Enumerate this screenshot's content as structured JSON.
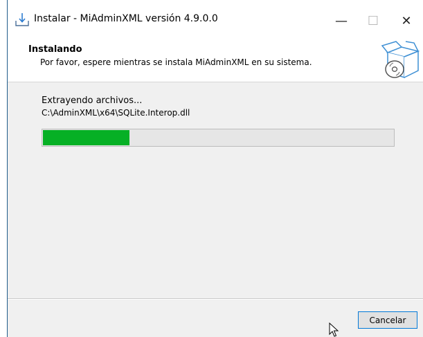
{
  "window": {
    "title": "Instalar - MiAdminXML versión 4.9.0.0",
    "controls": {
      "minimize": "—",
      "maximize": "☐",
      "close": "✕"
    }
  },
  "header": {
    "title": "Instalando",
    "subtitle": "Por favor, espere mientras se instala MiAdminXML en su sistema."
  },
  "body": {
    "status": "Extrayendo archivos...",
    "current_file": "C:\\AdminXML\\x64\\SQLite.Interop.dll",
    "progress_percent": 25
  },
  "footer": {
    "cancel_label": "Cancelar"
  },
  "colors": {
    "progress_fill": "#06b025",
    "button_focus_border": "#0078d7"
  },
  "icons": {
    "app": "download-tray-icon",
    "header": "installer-box-cd-icon",
    "pointer": "mouse-pointer-icon"
  }
}
